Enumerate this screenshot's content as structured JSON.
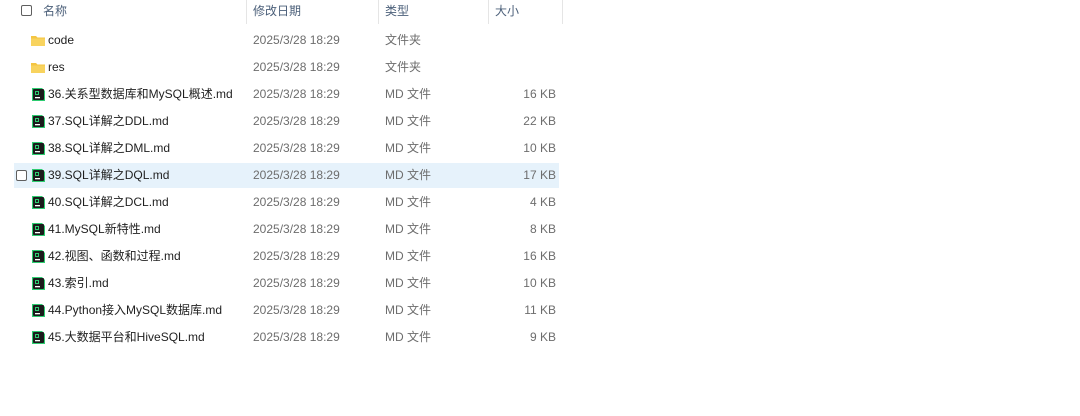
{
  "header": {
    "name": "名称",
    "modified": "修改日期",
    "type": "类型",
    "size": "大小",
    "sort_indicator": "chevron-up-icon"
  },
  "rows": [
    {
      "name": "code",
      "modified": "2025/3/28 18:29",
      "type": "文件夹",
      "size": "",
      "icon": "folder-icon",
      "selected": false
    },
    {
      "name": "res",
      "modified": "2025/3/28 18:29",
      "type": "文件夹",
      "size": "",
      "icon": "folder-icon",
      "selected": false
    },
    {
      "name": "36.关系型数据库和MySQL概述.md",
      "modified": "2025/3/28 18:29",
      "type": "MD 文件",
      "size": "16 KB",
      "icon": "md-file-icon",
      "selected": false
    },
    {
      "name": "37.SQL详解之DDL.md",
      "modified": "2025/3/28 18:29",
      "type": "MD 文件",
      "size": "22 KB",
      "icon": "md-file-icon",
      "selected": false
    },
    {
      "name": "38.SQL详解之DML.md",
      "modified": "2025/3/28 18:29",
      "type": "MD 文件",
      "size": "10 KB",
      "icon": "md-file-icon",
      "selected": false
    },
    {
      "name": "39.SQL详解之DQL.md",
      "modified": "2025/3/28 18:29",
      "type": "MD 文件",
      "size": "17 KB",
      "icon": "md-file-icon",
      "selected": true
    },
    {
      "name": "40.SQL详解之DCL.md",
      "modified": "2025/3/28 18:29",
      "type": "MD 文件",
      "size": "4 KB",
      "icon": "md-file-icon",
      "selected": false
    },
    {
      "name": "41.MySQL新特性.md",
      "modified": "2025/3/28 18:29",
      "type": "MD 文件",
      "size": "8 KB",
      "icon": "md-file-icon",
      "selected": false
    },
    {
      "name": "42.视图、函数和过程.md",
      "modified": "2025/3/28 18:29",
      "type": "MD 文件",
      "size": "16 KB",
      "icon": "md-file-icon",
      "selected": false
    },
    {
      "name": "43.索引.md",
      "modified": "2025/3/28 18:29",
      "type": "MD 文件",
      "size": "10 KB",
      "icon": "md-file-icon",
      "selected": false
    },
    {
      "name": "44.Python接入MySQL数据库.md",
      "modified": "2025/3/28 18:29",
      "type": "MD 文件",
      "size": "11 KB",
      "icon": "md-file-icon",
      "selected": false
    },
    {
      "name": "45.大数据平台和HiveSQL.md",
      "modified": "2025/3/28 18:29",
      "type": "MD 文件",
      "size": "9 KB",
      "icon": "md-file-icon",
      "selected": false
    }
  ],
  "colors": {
    "header_text": "#4c607a",
    "selected_row": "#e6f2fb",
    "folder": "#f4c542",
    "md_icon_dark": "#1b1b1b",
    "md_icon_green": "#2ecc71"
  }
}
